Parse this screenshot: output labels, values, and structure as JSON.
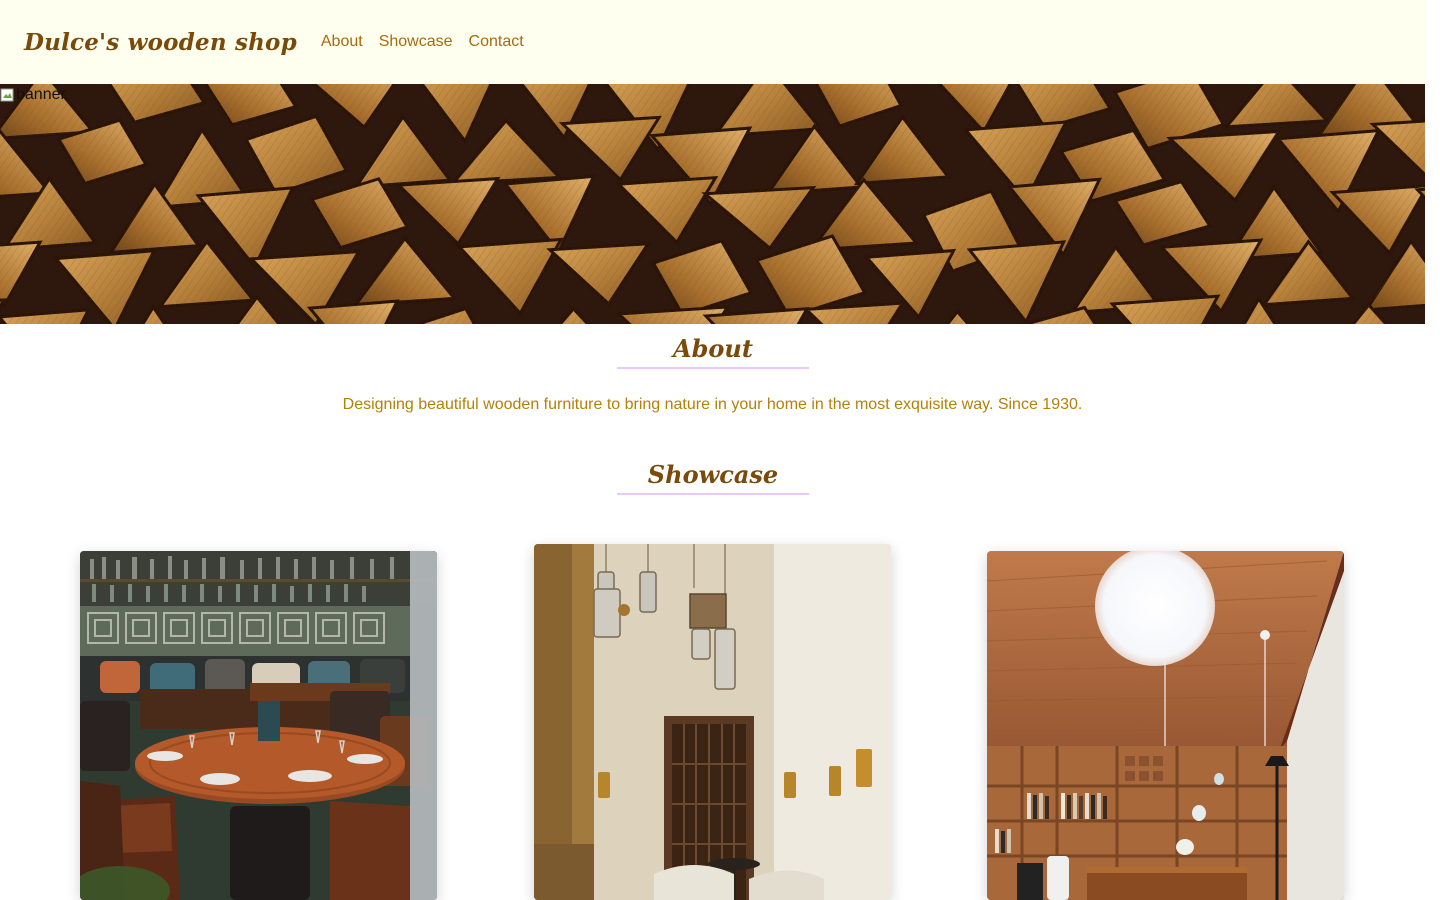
{
  "navbar": {
    "brand": "Dulce's wooden shop",
    "links": [
      {
        "label": "About"
      },
      {
        "label": "Showcase"
      },
      {
        "label": "Contact"
      }
    ]
  },
  "banner": {
    "alt_text": "banner"
  },
  "about": {
    "title": "About",
    "text": "Designing beautiful wooden furniture to bring nature in your home in the most exquisite way. Since 1930."
  },
  "showcase": {
    "title": "Showcase",
    "cards": [
      {
        "image": "restaurant-dining-room-photo"
      },
      {
        "image": "courtyard-lanterns-photo"
      },
      {
        "image": "wooden-library-room-photo"
      }
    ]
  },
  "colors": {
    "navbar_bg": "#fffff0",
    "brand": "#7a4a0a",
    "link": "#a86a0e",
    "about_text": "#b5800a",
    "title_underline": "#e7c9fb"
  }
}
